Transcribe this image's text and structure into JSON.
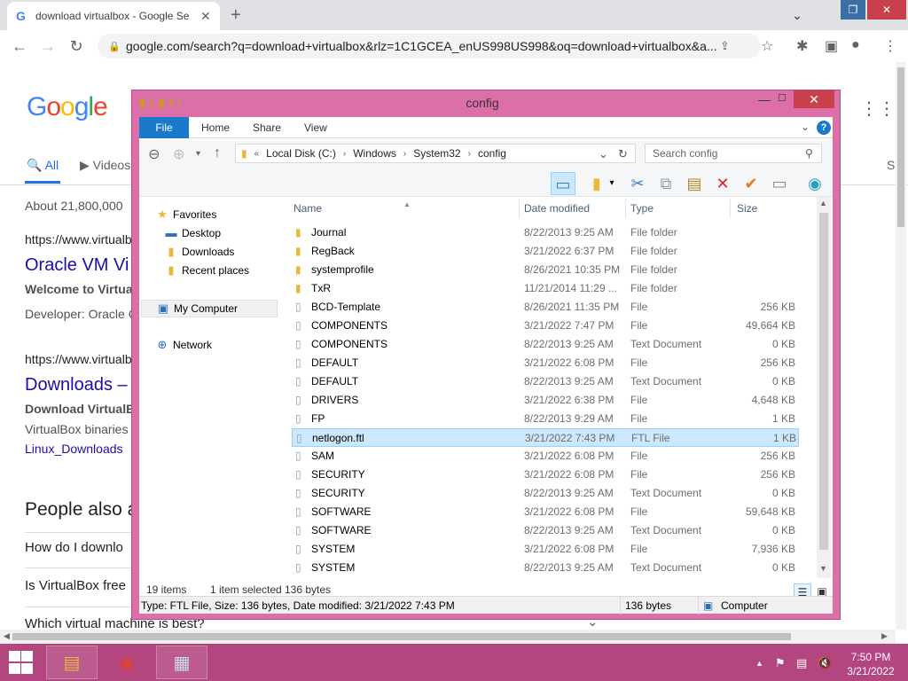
{
  "chrome": {
    "tab_title": "download virtualbox - Google Se",
    "url": "google.com/search?q=download+virtualbox&rlz=1C1GCEA_enUS998US998&oq=download+virtualbox&a..."
  },
  "google": {
    "logo": [
      "G",
      "o",
      "o",
      "g",
      "l",
      "e"
    ],
    "tabs": [
      "All",
      "Videos"
    ],
    "right_tab": "S",
    "about": "About 21,800,000",
    "result1_url": "https://www.virtualb",
    "result1_title": "Oracle VM Vi",
    "result1_snippet_bold": "Welcome to Virtual",
    "result1_developer": "Developer: Oracle C",
    "result2_url": "https://www.virtualb",
    "result2_title": "Downloads –",
    "result2_snippet_bold": "Download VirtualBo",
    "result2_snippet": "VirtualBox binaries",
    "result2_link": "Linux_Downloads",
    "people_also": "People also a",
    "q1": "How do I downlo",
    "q2": "Is VirtualBox free",
    "q3": "Which virtual machine is best?"
  },
  "explorer": {
    "title": "config",
    "ribbon_tabs": [
      "File",
      "Home",
      "Share",
      "View"
    ],
    "breadcrumb": [
      "Local Disk (C:)",
      "Windows",
      "System32",
      "config"
    ],
    "search_placeholder": "Search config",
    "nav": {
      "favorites": "Favorites",
      "desktop": "Desktop",
      "downloads": "Downloads",
      "recent": "Recent places",
      "computer": "My Computer",
      "network": "Network"
    },
    "columns": [
      "Name",
      "Date modified",
      "Type",
      "Size"
    ],
    "files": [
      {
        "name": "Journal",
        "date": "8/22/2013 9:25 AM",
        "type": "File folder",
        "size": "",
        "kind": "folder"
      },
      {
        "name": "RegBack",
        "date": "3/21/2022 6:37 PM",
        "type": "File folder",
        "size": "",
        "kind": "folder"
      },
      {
        "name": "systemprofile",
        "date": "8/26/2021 10:35 PM",
        "type": "File folder",
        "size": "",
        "kind": "folder"
      },
      {
        "name": "TxR",
        "date": "11/21/2014 11:29 ...",
        "type": "File folder",
        "size": "",
        "kind": "folder"
      },
      {
        "name": "BCD-Template",
        "date": "8/26/2021 11:35 PM",
        "type": "File",
        "size": "256 KB",
        "kind": "file"
      },
      {
        "name": "COMPONENTS",
        "date": "3/21/2022 7:47 PM",
        "type": "File",
        "size": "49,664 KB",
        "kind": "file"
      },
      {
        "name": "COMPONENTS",
        "date": "8/22/2013 9:25 AM",
        "type": "Text Document",
        "size": "0 KB",
        "kind": "file"
      },
      {
        "name": "DEFAULT",
        "date": "3/21/2022 6:08 PM",
        "type": "File",
        "size": "256 KB",
        "kind": "file"
      },
      {
        "name": "DEFAULT",
        "date": "8/22/2013 9:25 AM",
        "type": "Text Document",
        "size": "0 KB",
        "kind": "file"
      },
      {
        "name": "DRIVERS",
        "date": "3/21/2022 6:38 PM",
        "type": "File",
        "size": "4,648 KB",
        "kind": "file"
      },
      {
        "name": "FP",
        "date": "8/22/2013 9:29 AM",
        "type": "File",
        "size": "1 KB",
        "kind": "file"
      },
      {
        "name": "netlogon.ftl",
        "date": "3/21/2022 7:43 PM",
        "type": "FTL File",
        "size": "1 KB",
        "kind": "file",
        "selected": true
      },
      {
        "name": "SAM",
        "date": "3/21/2022 6:08 PM",
        "type": "File",
        "size": "256 KB",
        "kind": "file"
      },
      {
        "name": "SECURITY",
        "date": "3/21/2022 6:08 PM",
        "type": "File",
        "size": "256 KB",
        "kind": "file"
      },
      {
        "name": "SECURITY",
        "date": "8/22/2013 9:25 AM",
        "type": "Text Document",
        "size": "0 KB",
        "kind": "file"
      },
      {
        "name": "SOFTWARE",
        "date": "3/21/2022 6:08 PM",
        "type": "File",
        "size": "59,648 KB",
        "kind": "file"
      },
      {
        "name": "SOFTWARE",
        "date": "8/22/2013 9:25 AM",
        "type": "Text Document",
        "size": "0 KB",
        "kind": "file"
      },
      {
        "name": "SYSTEM",
        "date": "3/21/2022 6:08 PM",
        "type": "File",
        "size": "7,936 KB",
        "kind": "file"
      },
      {
        "name": "SYSTEM",
        "date": "8/22/2013 9:25 AM",
        "type": "Text Document",
        "size": "0 KB",
        "kind": "file"
      }
    ],
    "status": {
      "items": "19 items",
      "selected": "1 item selected",
      "sel_size": "136 bytes",
      "details": "Type: FTL File, Size: 136 bytes, Date modified: 3/21/2022 7:43 PM",
      "size2": "136 bytes",
      "location": "Computer"
    }
  },
  "taskbar": {
    "time": "7:50 PM",
    "date": "3/21/2022"
  },
  "colors": {
    "explorer_frame": "#dd6fa8",
    "taskbar": "#b3457f",
    "selection": "#cce8ff",
    "close_button": "#c7404c",
    "file_tab": "#1979ca"
  }
}
